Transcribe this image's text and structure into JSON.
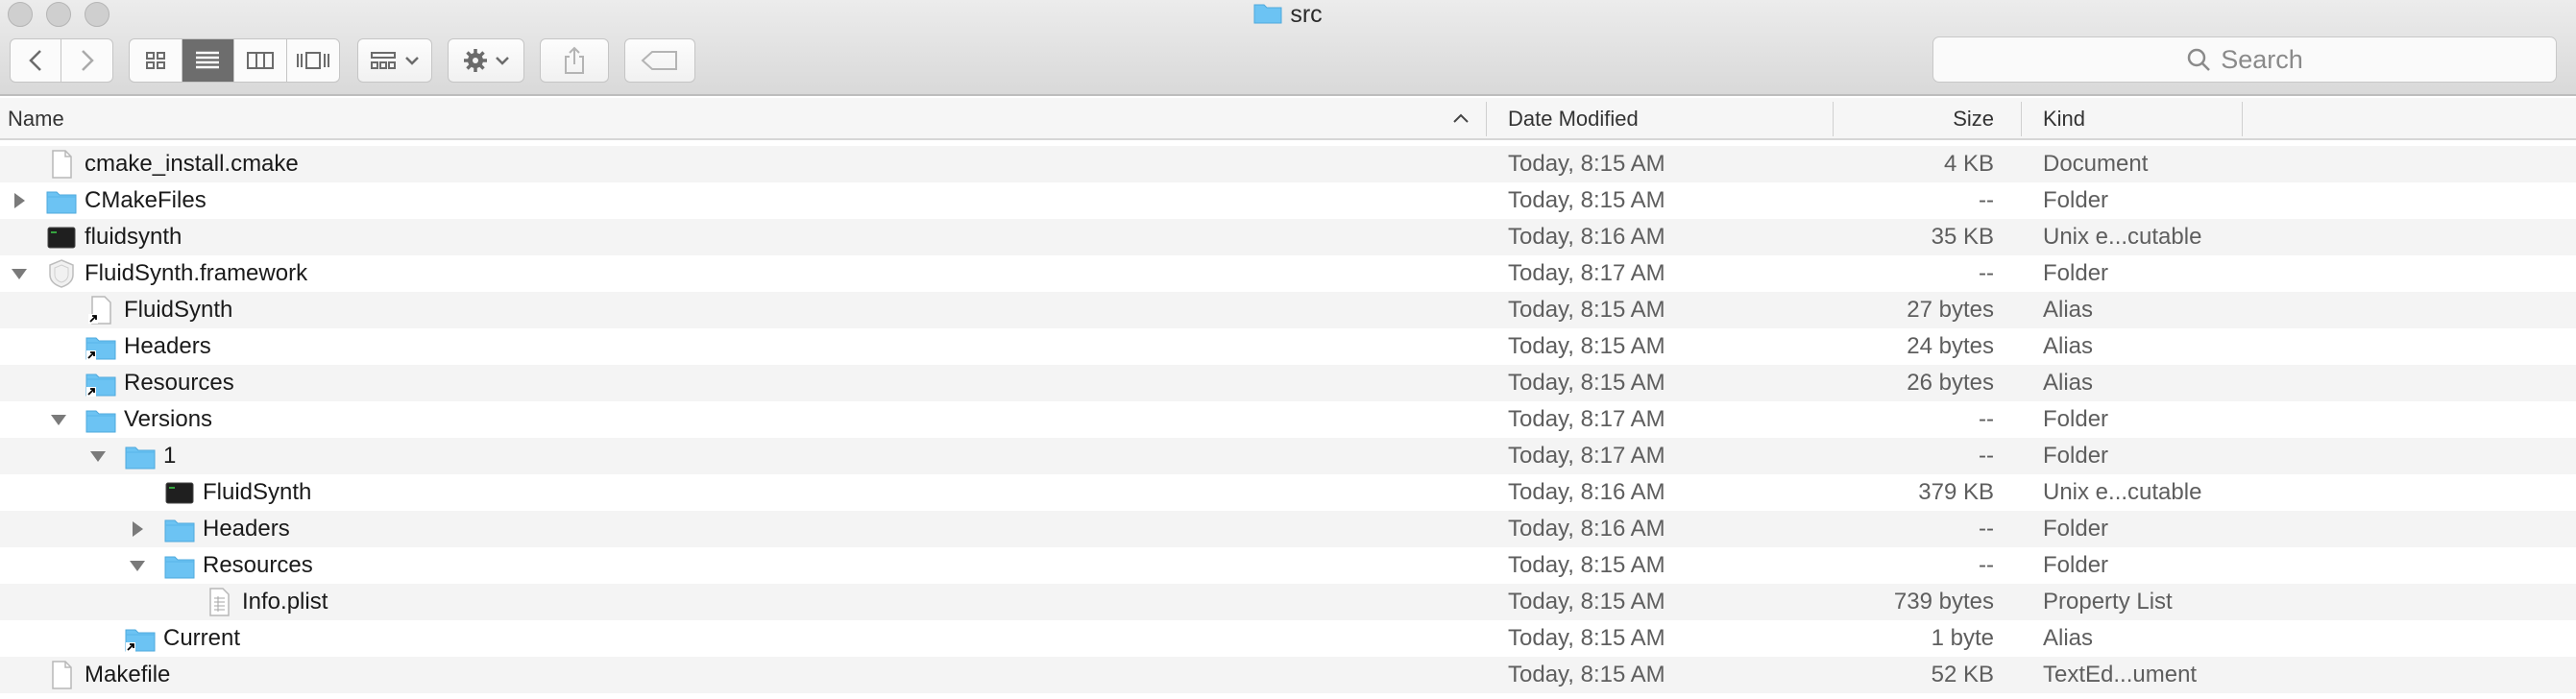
{
  "window": {
    "title": "src"
  },
  "toolbar": {
    "search_placeholder": "Search"
  },
  "columns": {
    "name": "Name",
    "date": "Date Modified",
    "size": "Size",
    "kind": "Kind"
  },
  "rows": [
    {
      "name": "cmake_install.cmake",
      "date": "Today, 8:15 AM",
      "size": "4 KB",
      "kind": "Document",
      "level": 0,
      "disclosure": "none",
      "icon": "document-icon"
    },
    {
      "name": "CMakeFiles",
      "date": "Today, 8:15 AM",
      "size": "--",
      "kind": "Folder",
      "level": 0,
      "disclosure": "collapsed",
      "icon": "folder-icon"
    },
    {
      "name": "fluidsynth",
      "date": "Today, 8:16 AM",
      "size": "35 KB",
      "kind": "Unix e...cutable",
      "level": 0,
      "disclosure": "none",
      "icon": "executable-icon"
    },
    {
      "name": "FluidSynth.framework",
      "date": "Today, 8:17 AM",
      "size": "--",
      "kind": "Folder",
      "level": 0,
      "disclosure": "expanded",
      "icon": "framework-icon"
    },
    {
      "name": "FluidSynth",
      "date": "Today, 8:15 AM",
      "size": "27 bytes",
      "kind": "Alias",
      "level": 1,
      "disclosure": "none",
      "icon": "alias-document-icon"
    },
    {
      "name": "Headers",
      "date": "Today, 8:15 AM",
      "size": "24 bytes",
      "kind": "Alias",
      "level": 1,
      "disclosure": "none",
      "icon": "alias-folder-icon"
    },
    {
      "name": "Resources",
      "date": "Today, 8:15 AM",
      "size": "26 bytes",
      "kind": "Alias",
      "level": 1,
      "disclosure": "none",
      "icon": "alias-folder-icon"
    },
    {
      "name": "Versions",
      "date": "Today, 8:17 AM",
      "size": "--",
      "kind": "Folder",
      "level": 1,
      "disclosure": "expanded",
      "icon": "folder-icon"
    },
    {
      "name": "1",
      "date": "Today, 8:17 AM",
      "size": "--",
      "kind": "Folder",
      "level": 2,
      "disclosure": "expanded",
      "icon": "folder-icon"
    },
    {
      "name": "FluidSynth",
      "date": "Today, 8:16 AM",
      "size": "379 KB",
      "kind": "Unix e...cutable",
      "level": 3,
      "disclosure": "none",
      "icon": "executable-icon"
    },
    {
      "name": "Headers",
      "date": "Today, 8:16 AM",
      "size": "--",
      "kind": "Folder",
      "level": 3,
      "disclosure": "collapsed",
      "icon": "folder-icon"
    },
    {
      "name": "Resources",
      "date": "Today, 8:15 AM",
      "size": "--",
      "kind": "Folder",
      "level": 3,
      "disclosure": "expanded",
      "icon": "folder-icon"
    },
    {
      "name": "Info.plist",
      "date": "Today, 8:15 AM",
      "size": "739 bytes",
      "kind": "Property List",
      "level": 4,
      "disclosure": "none",
      "icon": "plist-icon"
    },
    {
      "name": "Current",
      "date": "Today, 8:15 AM",
      "size": "1 byte",
      "kind": "Alias",
      "level": 2,
      "disclosure": "none",
      "icon": "alias-folder-icon"
    },
    {
      "name": "Makefile",
      "date": "Today, 8:15 AM",
      "size": "52 KB",
      "kind": "TextEd...ument",
      "level": 0,
      "disclosure": "none",
      "icon": "document-icon"
    }
  ],
  "colors": {
    "folder": "#6cc3f3",
    "selected_view": "#6d6d6d"
  }
}
